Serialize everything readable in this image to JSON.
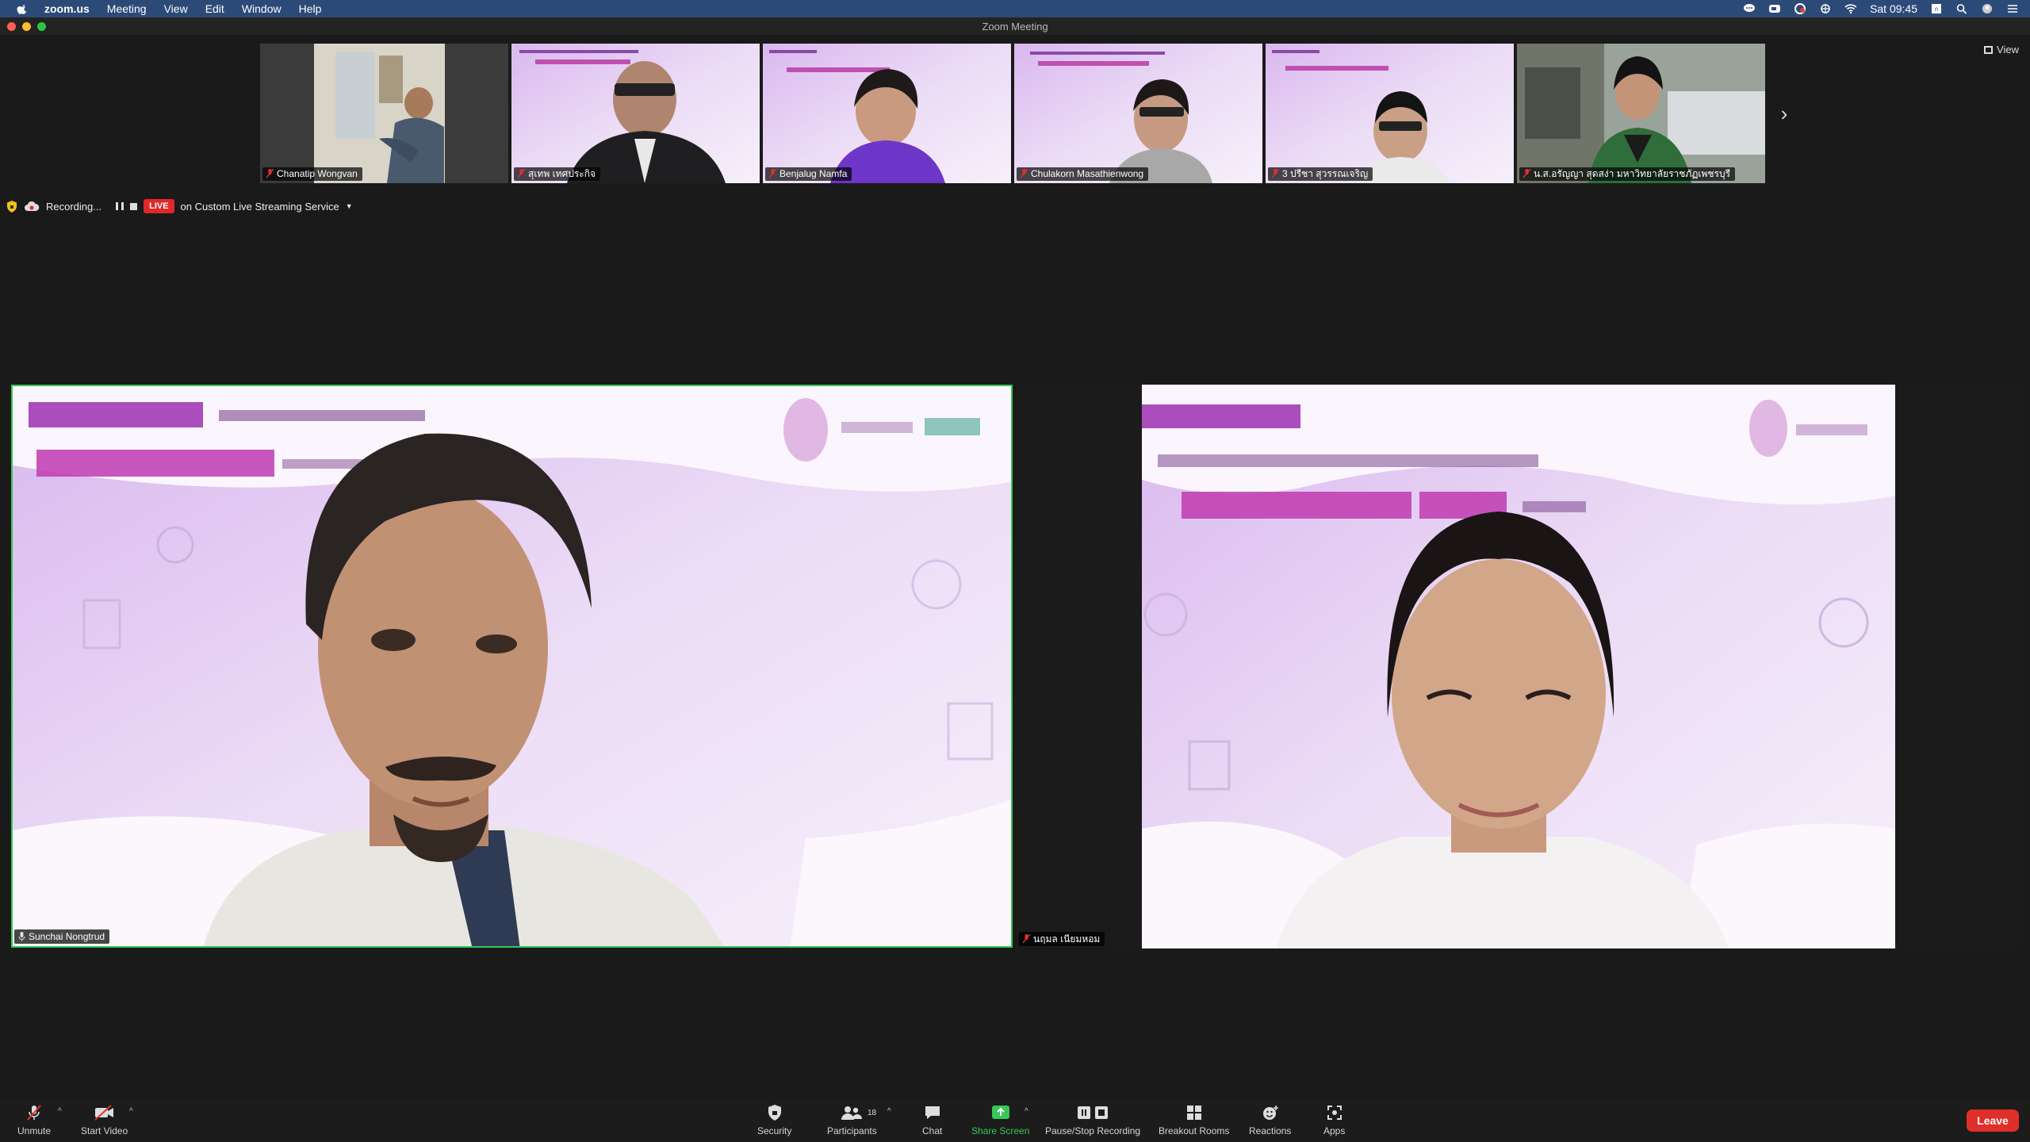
{
  "menubar": {
    "app_name": "zoom.us",
    "items": [
      "Meeting",
      "View",
      "Edit",
      "Window",
      "Help"
    ],
    "clock": "Sat 09:45"
  },
  "window": {
    "title": "Zoom Meeting"
  },
  "gallery": {
    "view_label": "View",
    "participants": [
      {
        "name": "Chanatip Wongvan"
      },
      {
        "name": "สุเทพ เทศประกิจ"
      },
      {
        "name": "Benjalug Namfa"
      },
      {
        "name": "Chulakorn Masathienwong"
      },
      {
        "name": "3 ปรีชา สุวรรณเจริญ"
      },
      {
        "name": "น.ส.อรัญญา สุดสง่า มหาวิทยาลัยราชภัฏเพชรบุรี"
      }
    ]
  },
  "recording": {
    "status": "Recording...",
    "live_badge": "LIVE",
    "stream_label": "on Custom Live Streaming Service"
  },
  "main_videos": {
    "left": {
      "name": "Sunchai Nongtrud"
    },
    "right": {
      "name": "นฤมล เนียมหอม"
    }
  },
  "toolbar": {
    "unmute": "Unmute",
    "start_video": "Start Video",
    "security": "Security",
    "participants": "Participants",
    "participant_count": "18",
    "chat": "Chat",
    "share_screen": "Share Screen",
    "pause_stop_recording": "Pause/Stop Recording",
    "breakout_rooms": "Breakout Rooms",
    "reactions": "Reactions",
    "apps": "Apps",
    "leave": "Leave"
  },
  "colors": {
    "accent_green": "#35c759",
    "leave_red": "#e02e2a",
    "live_red": "#e02828",
    "menubar_blue": "#2c4a78"
  }
}
